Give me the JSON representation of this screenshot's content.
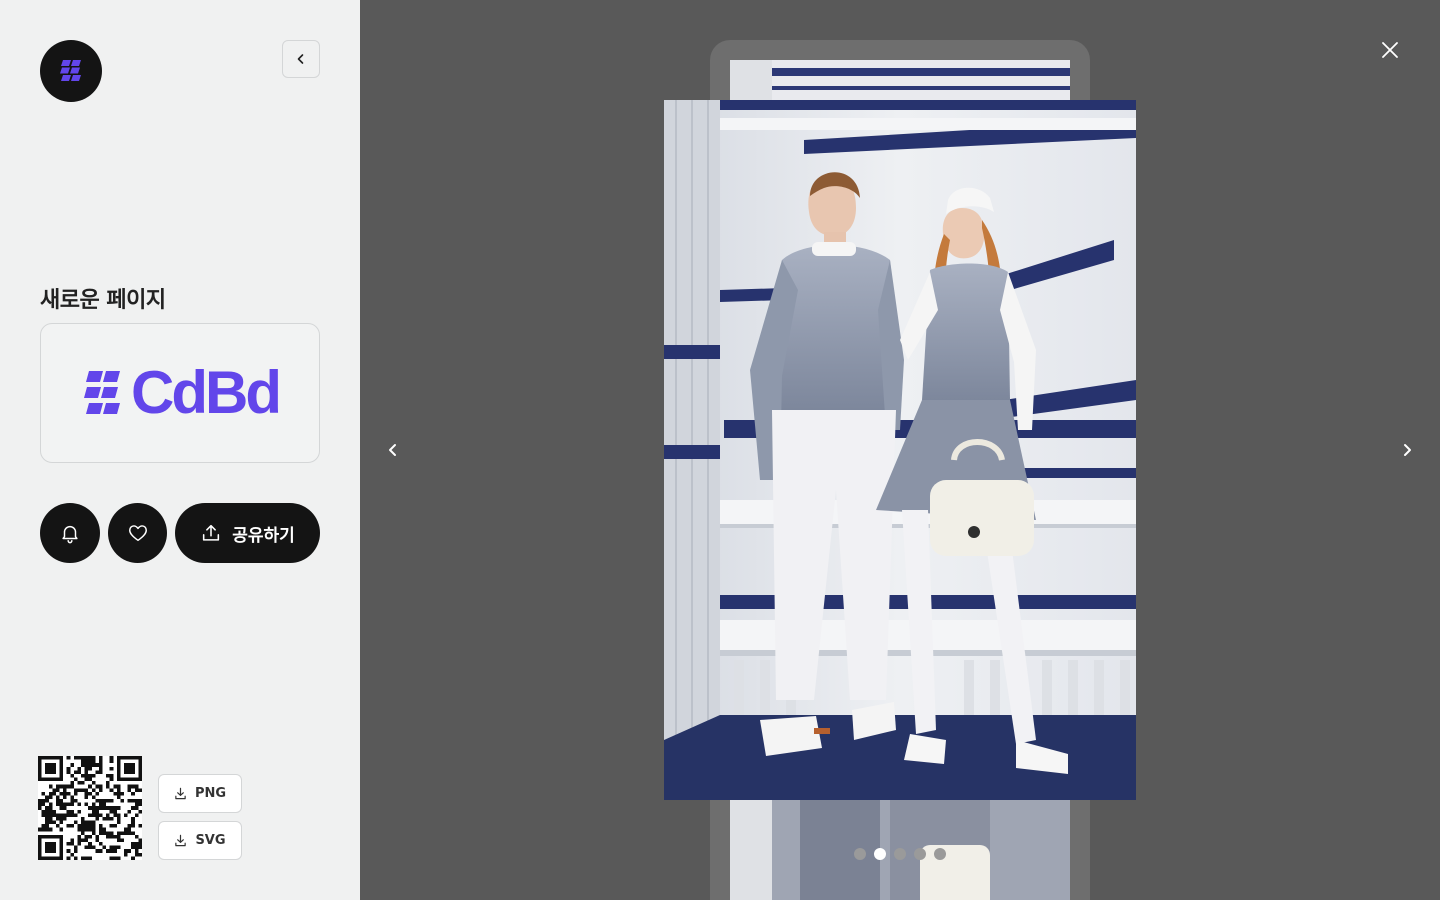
{
  "sidebar": {
    "page_title": "새로운 페이지",
    "logo_text": "CdBd",
    "share_label": "공유하기",
    "download_png_label": "PNG",
    "download_svg_label": "SVG"
  },
  "viewer": {
    "slide_count": 5,
    "active_slide": 2
  },
  "colors": {
    "brand": "#6246ea",
    "dark": "#141414",
    "sidebar_bg": "#f0f1f1",
    "viewer_bg": "#595959"
  },
  "icons": [
    "brand-mark-icon",
    "chevron-left-icon",
    "bell-icon",
    "heart-icon",
    "share-upload-icon",
    "download-icon",
    "close-icon",
    "chevron-right-icon",
    "qr-code-icon"
  ]
}
